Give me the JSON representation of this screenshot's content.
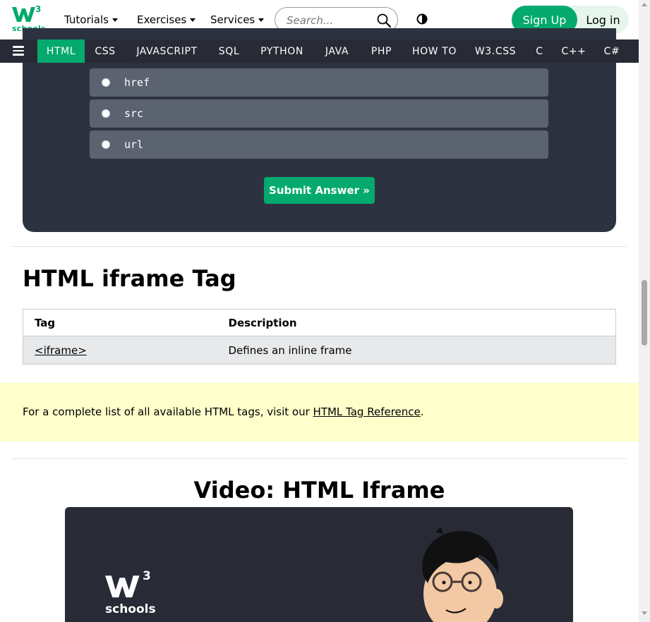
{
  "header": {
    "logo_superscript": "3",
    "logo_text": "schools",
    "menus": [
      {
        "label": "Tutorials"
      },
      {
        "label": "Exercises"
      },
      {
        "label": "Services"
      }
    ],
    "search_placeholder": "Search...",
    "signup_label": "Sign Up",
    "login_label": "Log in",
    "brand_color": "#04aa6d"
  },
  "nav": {
    "items": [
      "HTML",
      "CSS",
      "JAVASCRIPT",
      "SQL",
      "PYTHON",
      "JAVA",
      "PHP",
      "HOW TO",
      "W3.CSS",
      "C",
      "C++",
      "C#"
    ],
    "active": "HTML"
  },
  "quiz": {
    "options": [
      "href",
      "src",
      "url"
    ],
    "submit_label": "Submit Answer »"
  },
  "iframe_section": {
    "heading": "HTML iframe Tag",
    "table": {
      "headers": [
        "Tag",
        "Description"
      ],
      "rows": [
        [
          "<iframe>",
          "Defines an inline frame"
        ]
      ]
    }
  },
  "note": {
    "text_before": "For a complete list of all available HTML tags, visit our ",
    "link_text": "HTML Tag Reference",
    "text_after": "."
  },
  "video": {
    "heading": "Video: HTML Iframe",
    "logo_superscript": "3",
    "logo_text": "schools"
  }
}
